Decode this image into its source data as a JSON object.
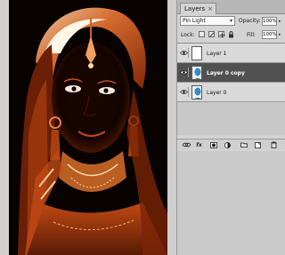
{
  "panel": {
    "tab_label": "Layers",
    "close_glyph": "×",
    "blend_mode": "Pin Light",
    "opacity_label": "Opacity:",
    "opacity_value": "100%",
    "lock_label": "Lock:",
    "fill_label": "Fill:",
    "fill_value": "100%"
  },
  "layers": [
    {
      "name": "Layer 1",
      "visible": true,
      "thumbnail": "blank-white"
    },
    {
      "name": "Layer 0 copy",
      "visible": true,
      "selected": true,
      "thumbnail": "portrait-blue"
    },
    {
      "name": "Layer 0",
      "visible": true,
      "thumbnail": "portrait-blue"
    }
  ],
  "footer_buttons": [
    "link-icon",
    "fx-icon",
    "mask-icon",
    "adjustment-icon",
    "group-folder-icon",
    "new-layer-icon",
    "trash-icon"
  ],
  "footer_fx_label": "fx",
  "colors": {
    "selected_row": "#515151",
    "artwork_dark": "#0a0300",
    "artwork_glow": "#e0561e"
  }
}
